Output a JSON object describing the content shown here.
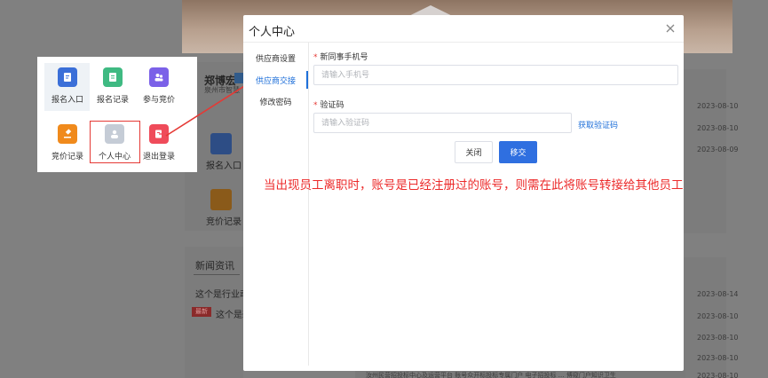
{
  "background": {
    "user_name": "郑博宏",
    "user_sub": "泉州市智慧",
    "shortcut_1": "报名入口",
    "shortcut_2": "竞价记录",
    "news_title": "新闻资讯",
    "news_item_1": "这个是行业动态",
    "news_tag": "最新",
    "news_item_2": "这个是新",
    "dates": [
      "2023-08-10",
      "2023-08-10",
      "2023-08-09",
      "2023-08-14",
      "2023-08-10",
      "2023-08-10",
      "2023-08-10",
      "2023-08-10"
    ],
    "bottom_text": "汝州民营招投标中心及运营平台  账号众开标投标专属门户  电子招投标  …  博窥门户知识卫生"
  },
  "callout": {
    "items": [
      {
        "label": "报名入口",
        "color": "#3b6fd8"
      },
      {
        "label": "报名记录",
        "color": "#3fba82"
      },
      {
        "label": "参与竞价",
        "color": "#7b61e8"
      },
      {
        "label": "竞价记录",
        "color": "#f08a1c"
      },
      {
        "label": "个人中心",
        "color": "#c5ccd6"
      },
      {
        "label": "退出登录",
        "color": "#ef4b5a"
      }
    ]
  },
  "modal": {
    "title": "个人中心",
    "tabs": [
      {
        "label": "供应商设置"
      },
      {
        "label": "供应商交接"
      },
      {
        "label": "修改密码"
      }
    ],
    "active_tab": "供应商交接",
    "phone": {
      "label": "新同事手机号",
      "placeholder": "请输入手机号",
      "value": ""
    },
    "code": {
      "label": "验证码",
      "placeholder": "请输入验证码",
      "value": ""
    },
    "get_code": "获取验证码",
    "cancel": "关闭",
    "submit": "移交"
  },
  "annotation": "当出现员工离职时，账号是已经注册过的账号，则需在此将账号转接给其他员工",
  "colors": {
    "accent": "#2f6fe0",
    "annotation": "#ec2a2a",
    "required": "#e53935"
  }
}
